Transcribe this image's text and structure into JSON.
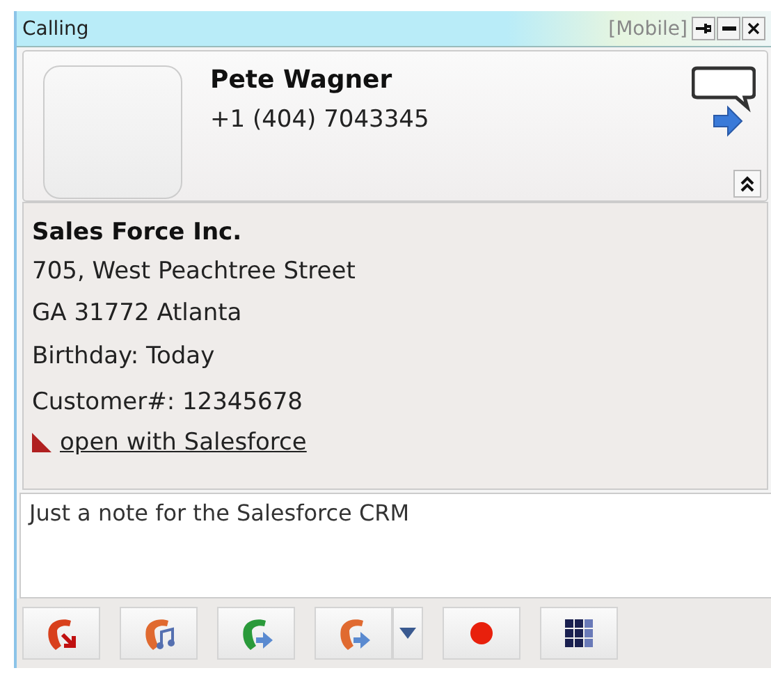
{
  "window": {
    "title": "Calling",
    "mode": "[Mobile]",
    "controls": [
      {
        "kind": "pin"
      },
      {
        "kind": "minimize"
      },
      {
        "kind": "close"
      }
    ]
  },
  "contact": {
    "name": "Pete Wagner",
    "phone": "+1 (404) 7043345"
  },
  "details": {
    "company": "Sales Force Inc.",
    "address": [
      "705, West Peachtree Street",
      "GA 31772 Atlanta"
    ],
    "info": [
      "Birthday: Today",
      "Customer#: 12345678"
    ],
    "link": "open with Salesforce"
  },
  "note": {
    "value": "Just a note for the Salesforce CRM"
  },
  "toolbar": [
    {
      "kind": "hangup"
    },
    {
      "kind": "hold"
    },
    {
      "kind": "transfer"
    },
    {
      "kind": "forward"
    },
    {
      "kind": "record"
    },
    {
      "kind": "keypad"
    }
  ]
}
